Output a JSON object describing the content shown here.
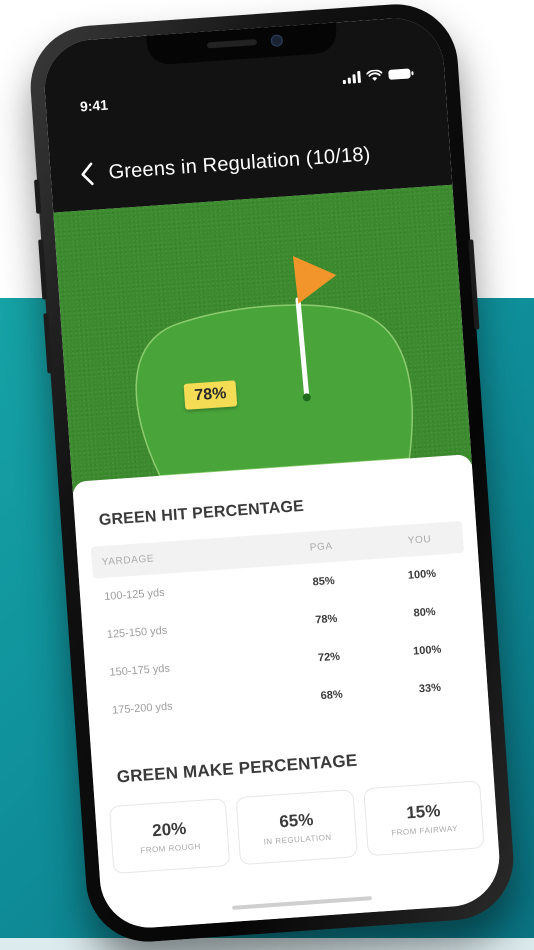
{
  "status": {
    "time": "9:41"
  },
  "nav": {
    "title": "Greens in Regulation (10/18)"
  },
  "green": {
    "hit_badge": "78%",
    "flag_color": "#f2962b",
    "grass_color": "#3c8a2e"
  },
  "hit_section": {
    "title": "GREEN HIT PERCENTAGE",
    "columns": [
      "YARDAGE",
      "PGA",
      "YOU"
    ],
    "rows": [
      {
        "yardage": "100-125 yds",
        "pga": "85%",
        "you": "100%"
      },
      {
        "yardage": "125-150 yds",
        "pga": "78%",
        "you": "80%"
      },
      {
        "yardage": "150-175 yds",
        "pga": "72%",
        "you": "100%"
      },
      {
        "yardage": "175-200 yds",
        "pga": "68%",
        "you": "33%"
      }
    ]
  },
  "make_section": {
    "title": "GREEN MAKE PERCENTAGE",
    "boxes": [
      {
        "value": "20%",
        "label": "FROM ROUGH"
      },
      {
        "value": "65%",
        "label": "IN REGULATION"
      },
      {
        "value": "15%",
        "label": "FROM FAIRWAY"
      }
    ]
  },
  "colors": {
    "teal": "#129aa0",
    "header": "#121212",
    "badge": "#f4dc55"
  }
}
